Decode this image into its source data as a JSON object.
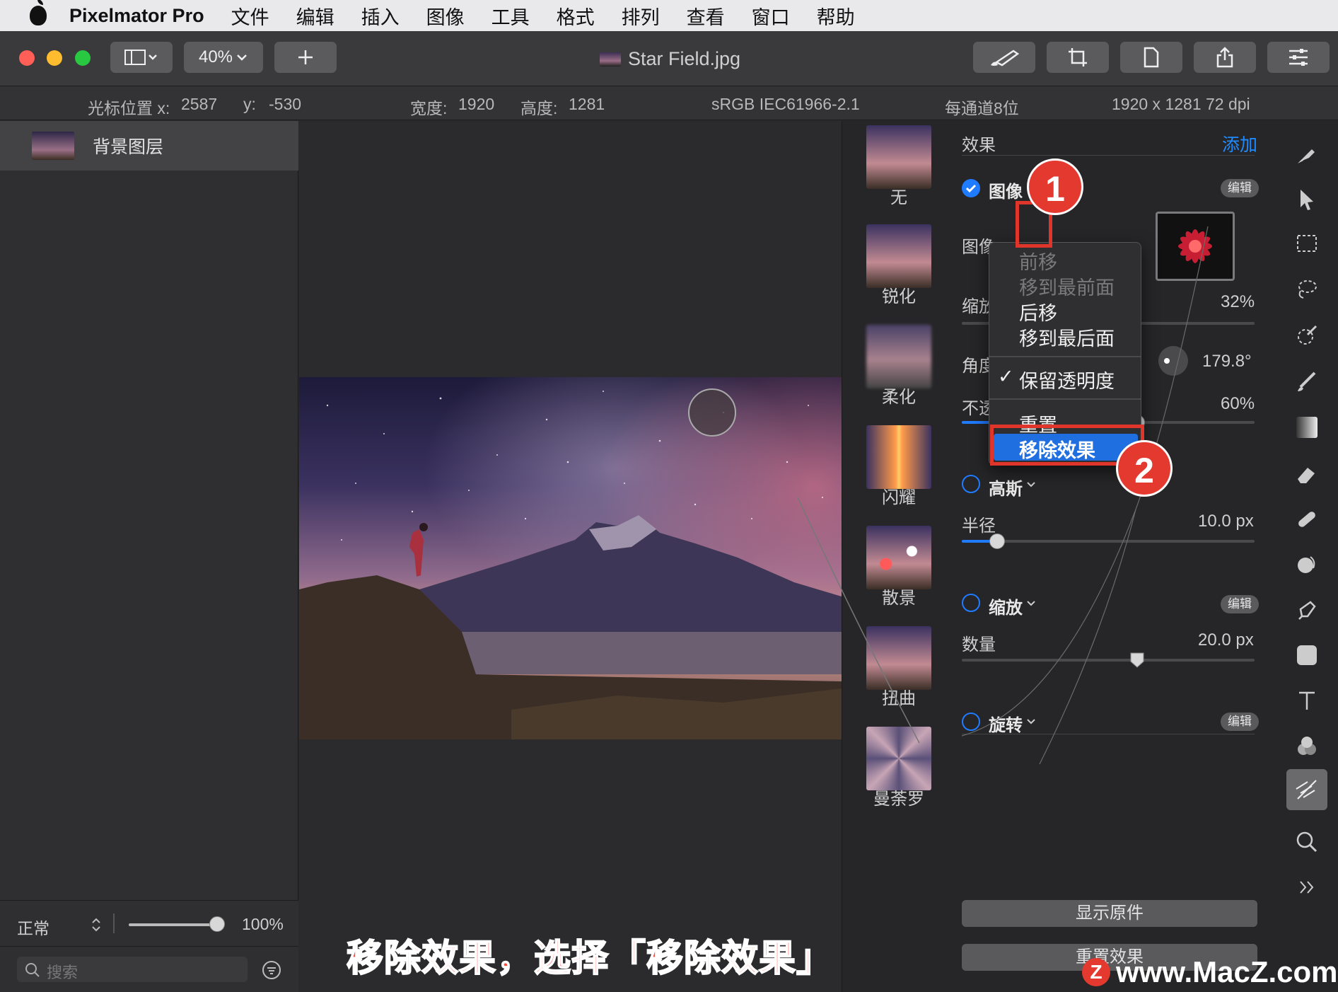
{
  "menubar": {
    "app_name": "Pixelmator Pro",
    "items": [
      "文件",
      "编辑",
      "插入",
      "图像",
      "工具",
      "格式",
      "排列",
      "查看",
      "窗口",
      "帮助"
    ]
  },
  "toolbar": {
    "zoom": "40%",
    "doc_title": "Star Field.jpg"
  },
  "infobar": {
    "cursor_x_label": "光标位置 x:",
    "cursor_x": "2587",
    "cursor_y_label": "y:",
    "cursor_y": "-530",
    "width_label": "宽度:",
    "width": "1920",
    "height_label": "高度:",
    "height": "1281",
    "color_profile": "sRGB IEC61966-2.1",
    "bit_depth": "每通道8位",
    "resolution": "1920 x 1281 72 dpi"
  },
  "layers": {
    "items": [
      {
        "label": "背景图层"
      }
    ],
    "blend_mode": "正常",
    "opacity": "100%",
    "search_placeholder": "搜索"
  },
  "effects_browser": {
    "items": [
      {
        "label": "无"
      },
      {
        "label": "锐化"
      },
      {
        "label": "柔化"
      },
      {
        "label": "闪耀"
      },
      {
        "label": "散景"
      },
      {
        "label": "扭曲"
      },
      {
        "label": "曼荼罗"
      }
    ]
  },
  "settings": {
    "header": "效果",
    "add_label": "添加",
    "edit_label": "编辑",
    "image_effect": {
      "name": "图像",
      "image_label": "图像",
      "scale_label": "缩放",
      "scale_value": "32%",
      "angle_label": "角度",
      "angle_value": "179.8°",
      "opacity_label": "不透明度 (浅色)",
      "opacity_value": "60%",
      "opacity_level": 0.6
    },
    "gaussian": {
      "name": "高斯",
      "radius_label": "半径",
      "radius_value": "10.0 px",
      "radius_level": 0.12
    },
    "zoom_effect": {
      "name": "缩放",
      "amount_label": "数量",
      "amount_value": "20.0 px",
      "amount_level": 0.6
    },
    "rotate_effect": {
      "name": "旋转"
    },
    "show_original": "显示原件",
    "reset_effects": "重置效果"
  },
  "popup": {
    "items": [
      "前移",
      "移到最前面",
      "后移",
      "移到最后面"
    ],
    "preserve_transparency": "保留透明度",
    "reset": "重置",
    "remove": "移除效果",
    "checkmark": "✓"
  },
  "annotations": {
    "badge1": "1",
    "badge2": "2",
    "caption": "移除效果，选择「移除效果」",
    "watermark": "www.MacZ.com",
    "watermark_logo": "Z"
  }
}
